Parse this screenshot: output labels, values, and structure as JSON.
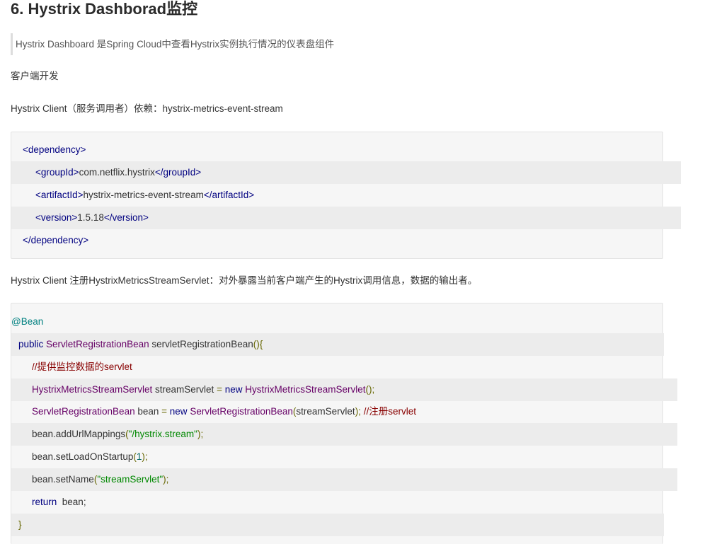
{
  "heading": "6. Hystrix Dashborad监控",
  "quote": "Hystrix Dashboard 是Spring Cloud中查看Hystrix实例执行情况的仪表盘组件",
  "para1": "客户端开发",
  "para2": "Hystrix Client（服务调用者）依赖：hystrix-metrics-event-stream",
  "xml": {
    "open_dep": "<dependency>",
    "gid_open": "<groupId>",
    "gid_val": "com.netflix.hystrix",
    "gid_close": "</groupId>",
    "aid_open": "<artifactId>",
    "aid_val": "hystrix-metrics-event-stream",
    "aid_close": "</artifactId>",
    "ver_open": "<version>",
    "ver_val": "1.5.18",
    "ver_close": "</version>",
    "close_dep": "</dependency>"
  },
  "para3": "Hystrix Client 注册HystrixMetricsStreamServlet：对外暴露当前客户端产生的Hystrix调用信息，数据的输出者。",
  "java": {
    "annotation": "@Bean",
    "l2_kw": "public",
    "l2_cls": "ServletRegistrationBean",
    "l2_rest": " servletRegistrationBean",
    "l2_pun": "(){",
    "l3_cmt": "//提供监控数据的servlet",
    "l4_cls": "HystrixMetricsStreamServlet",
    "l4_var": " streamServlet ",
    "l4_eq": "=",
    "l4_new": " new ",
    "l4_cls2": "HystrixMetricsStreamServlet",
    "l4_pun": "();",
    "l5_cls": "ServletRegistrationBean",
    "l5_var": " bean ",
    "l5_eq": "=",
    "l5_new": " new ",
    "l5_cls2": "ServletRegistrationBean",
    "l5_arg_open": "(",
    "l5_arg": "streamServlet",
    "l5_arg_close": ");",
    "l5_cmt": " //注册servlet",
    "l6_call": "bean.addUrlMappings",
    "l6_open": "(",
    "l6_str": "\"/hystrix.stream\"",
    "l6_close": ");",
    "l7_call": "bean.setLoadOnStartup",
    "l7_open": "(",
    "l7_num": "1",
    "l7_close": ");",
    "l8_call": "bean.setName",
    "l8_open": "(",
    "l8_str": "\"streamServlet\"",
    "l8_close": ");",
    "l9_kw": "return",
    "l9_rest": "  bean;",
    "l10": "}"
  }
}
